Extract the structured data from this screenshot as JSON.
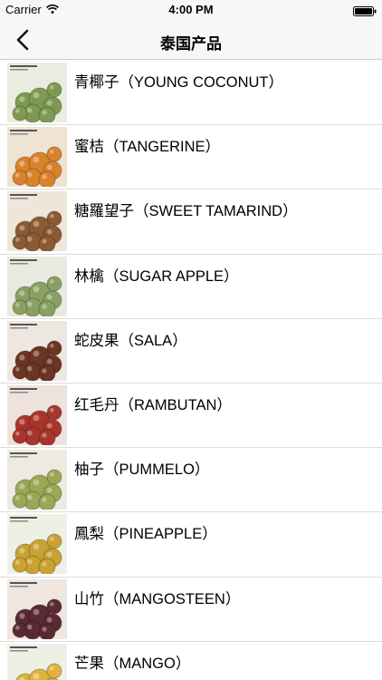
{
  "status_bar": {
    "carrier": "Carrier",
    "time": "4:00 PM"
  },
  "nav": {
    "title": "泰国产品",
    "back_icon": "chevron-left-icon"
  },
  "products": [
    {
      "label": "青椰子（YOUNG COCONUT）",
      "thumb_caption": "YOUNG COCONUT",
      "color": "#7e9a52",
      "bg": "#e9ede0"
    },
    {
      "label": "蜜桔（TANGERINE）",
      "thumb_caption": "TANGERINE",
      "color": "#d9822b",
      "bg": "#efe3d2"
    },
    {
      "label": "糖羅望子（SWEET TAMARIND）",
      "thumb_caption": "SWEET TAMARIND",
      "color": "#8b5a33",
      "bg": "#efe6da"
    },
    {
      "label": " 林檎（SUGAR APPLE）",
      "thumb_caption": "SUGAR APPLE",
      "color": "#8aa063",
      "bg": "#e9eadf"
    },
    {
      "label": "蛇皮果（SALA）",
      "thumb_caption": "SALA",
      "color": "#6b3523",
      "bg": "#eee7e0"
    },
    {
      "label": "红毛丹（RAMBUTAN）",
      "thumb_caption": "RAMBUTAN",
      "color": "#a8352c",
      "bg": "#eee3dc"
    },
    {
      "label": "柚子（PUMMELO）",
      "thumb_caption": "PUMMELO",
      "color": "#9aa856",
      "bg": "#eeeadf"
    },
    {
      "label": "鳳梨（PINEAPPLE）",
      "thumb_caption": "PINEAPPLE",
      "color": "#c9a233",
      "bg": "#eef0e4"
    },
    {
      "label": " 山竹（MANGOSTEEN）",
      "thumb_caption": "MANGOSTEEN",
      "color": "#5a2a33",
      "bg": "#eee6df"
    },
    {
      "label": "芒果（MANGO）",
      "thumb_caption": "MANGO",
      "color": "#e0b43c",
      "bg": "#eef0e6"
    }
  ]
}
